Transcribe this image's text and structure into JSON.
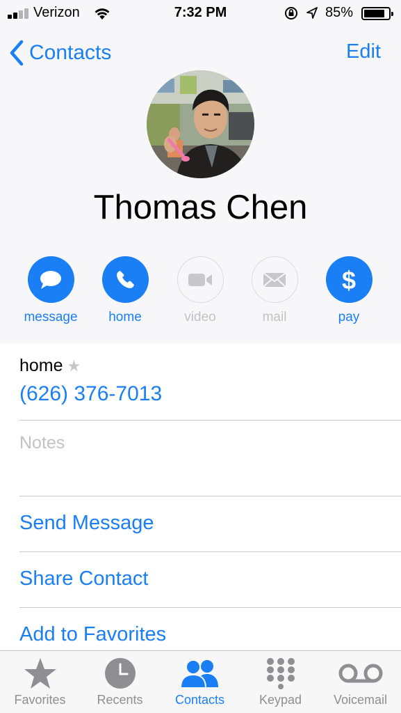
{
  "status_bar": {
    "carrier": "Verizon",
    "time": "7:32 PM",
    "battery_percent": "85%",
    "battery_level": 0.85,
    "signal_bars_filled": 2
  },
  "nav": {
    "back_label": "Contacts",
    "edit_label": "Edit"
  },
  "contact": {
    "name": "Thomas Chen"
  },
  "actions": [
    {
      "label": "message",
      "icon": "message-bubble-icon",
      "enabled": true
    },
    {
      "label": "home",
      "icon": "phone-icon",
      "enabled": true
    },
    {
      "label": "video",
      "icon": "video-camera-icon",
      "enabled": false
    },
    {
      "label": "mail",
      "icon": "envelope-icon",
      "enabled": false
    },
    {
      "label": "pay",
      "icon": "dollar-icon",
      "enabled": true
    }
  ],
  "phone": {
    "label": "home",
    "number": "(626) 376-7013"
  },
  "notes": {
    "placeholder": "Notes"
  },
  "links": {
    "send_message": "Send Message",
    "share_contact": "Share Contact",
    "add_to_favorites": "Add to Favorites"
  },
  "tabs": [
    {
      "label": "Favorites",
      "icon": "star-icon",
      "active": false
    },
    {
      "label": "Recents",
      "icon": "clock-icon",
      "active": false
    },
    {
      "label": "Contacts",
      "icon": "contacts-icon",
      "active": true
    },
    {
      "label": "Keypad",
      "icon": "keypad-icon",
      "active": false
    },
    {
      "label": "Voicemail",
      "icon": "voicemail-icon",
      "active": false
    }
  ],
  "colors": {
    "accent": "#1a7ef5",
    "header_bg": "#f7f7f9",
    "disabled": "#c2c2c6",
    "separator": "#c8c7cc",
    "tab_inactive": "#8e8e93"
  }
}
